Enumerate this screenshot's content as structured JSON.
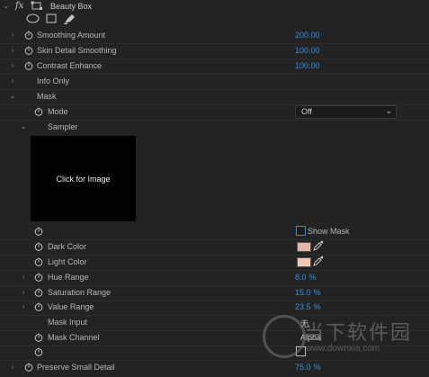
{
  "effect": {
    "title": "Beauty Box",
    "fx_label": "fx"
  },
  "rows": {
    "smoothing": {
      "label": "Smoothing Amount",
      "value": "200.00"
    },
    "skin_detail": {
      "label": "Skin Detail Smoothing",
      "value": "100.00"
    },
    "contrast": {
      "label": "Contrast Enhance",
      "value": "100.00"
    },
    "info_only": {
      "label": "Info Only"
    },
    "mask": {
      "label": "Mask"
    },
    "mode": {
      "label": "Mode",
      "value": "Off"
    },
    "sampler": {
      "label": "Sampler"
    },
    "preview": {
      "label": "Click for Image"
    },
    "show_mask": {
      "label": "Show Mask"
    },
    "dark_color": {
      "label": "Dark Color",
      "color": "#e8b6a8"
    },
    "light_color": {
      "label": "Light Color",
      "color": "#f3c7b0"
    },
    "hue_range": {
      "label": "Hue Range",
      "value": "8.0",
      "unit": "%"
    },
    "saturation_range": {
      "label": "Saturation Range",
      "value": "15.0",
      "unit": "%"
    },
    "value_range": {
      "label": "Value Range",
      "value": "23.5",
      "unit": "%"
    },
    "mask_input": {
      "label": "Mask Input",
      "value": "无"
    },
    "mask_channel": {
      "label": "Mask Channel",
      "value": "Alpha"
    },
    "preserve_detail": {
      "label": "Preserve Small Detail",
      "value": "75.0",
      "unit": "%"
    }
  },
  "watermark": {
    "text": "当下软件园",
    "url": "www.downxia.com"
  },
  "colors": {
    "accent": "#2f8ee6",
    "panel_bg": "#232323"
  }
}
